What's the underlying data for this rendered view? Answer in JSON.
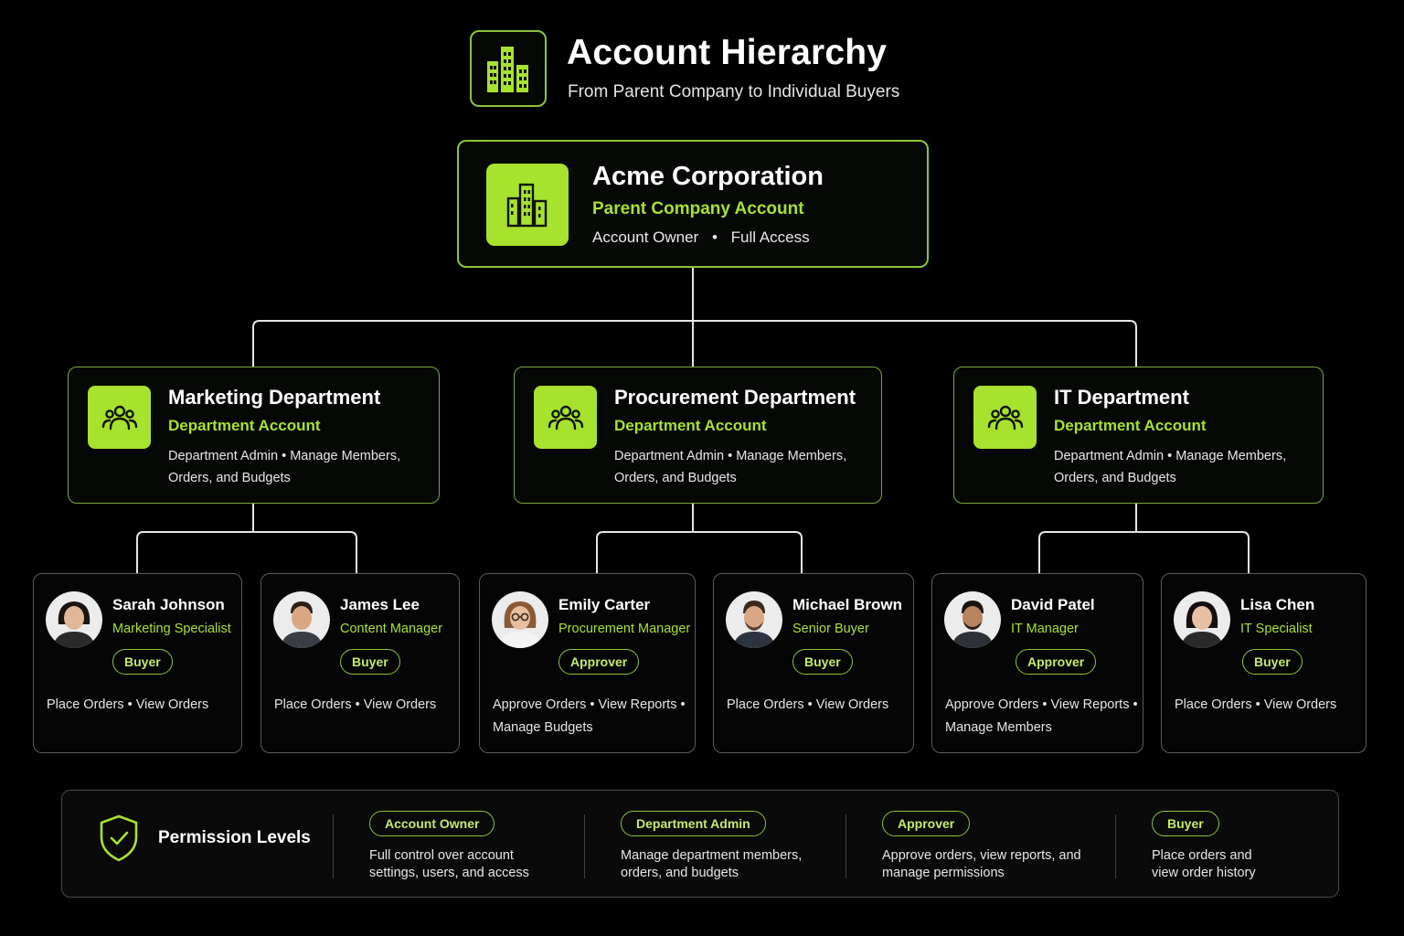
{
  "header": {
    "title": "Account Hierarchy",
    "subtitle": "From Parent Company to Individual Buyers",
    "icon": "buildings-icon"
  },
  "colors": {
    "accent": "#a6e22e",
    "background": "#000000",
    "card_border": "#8bc43a"
  },
  "root": {
    "name": "Acme Corporation",
    "type": "Parent Company Account",
    "role": "Account Owner",
    "separator": "•",
    "access": "Full Access",
    "icon": "buildings-icon"
  },
  "departments": [
    {
      "name": "Marketing Department",
      "type": "Department Account",
      "description": "Department Admin  •  Manage Members, Orders, and Budgets",
      "icon": "users-icon"
    },
    {
      "name": "Procurement Department",
      "type": "Department Account",
      "description": "Department Admin  •  Manage Members, Orders, and Budgets",
      "icon": "users-icon"
    },
    {
      "name": "IT Department",
      "type": "Department Account",
      "description": "Department Admin  •  Manage Members, Orders, and Budgets",
      "icon": "users-icon"
    }
  ],
  "people": [
    {
      "name": "Sarah Johnson",
      "title": "Marketing Specialist",
      "badge": "Buyer",
      "permissions": "Place Orders  •  View Orders"
    },
    {
      "name": "James Lee",
      "title": "Content Manager",
      "badge": "Buyer",
      "permissions": "Place Orders  •  View Orders"
    },
    {
      "name": "Emily Carter",
      "title": "Procurement Manager",
      "badge": "Approver",
      "permissions": "Approve Orders  •  View Reports  •  Manage Budgets"
    },
    {
      "name": "Michael Brown",
      "title": "Senior Buyer",
      "badge": "Buyer",
      "permissions": "Place Orders  •  View Orders"
    },
    {
      "name": "David Patel",
      "title": "IT Manager",
      "badge": "Approver",
      "permissions": "Approve Orders  •  View Reports  •  Manage Members"
    },
    {
      "name": "Lisa Chen",
      "title": "IT Specialist",
      "badge": "Buyer",
      "permissions": "Place Orders  •  View Orders"
    }
  ],
  "legend": {
    "title": "Permission Levels",
    "icon": "shield-check-icon",
    "levels": [
      {
        "label": "Account Owner",
        "description": "Full control over account settings, users, and access"
      },
      {
        "label": "Department Admin",
        "description": "Manage department members, orders, and budgets"
      },
      {
        "label": "Approver",
        "description": "Approve orders, view reports, and manage permissions"
      },
      {
        "label": "Buyer",
        "description": "Place orders and view order history"
      }
    ]
  }
}
